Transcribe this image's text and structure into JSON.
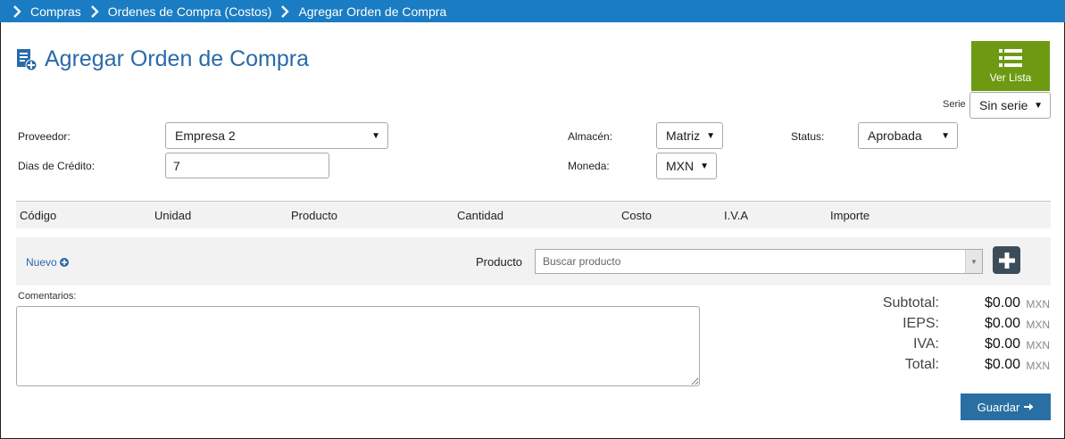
{
  "breadcrumb": [
    {
      "label": "Compras"
    },
    {
      "label": "Ordenes de Compra (Costos)"
    },
    {
      "label": "Agregar Orden de Compra"
    }
  ],
  "page_title": "Agregar Orden de Compra",
  "ver_lista_label": "Ver Lista",
  "serie": {
    "label": "Serie",
    "value": "Sin serie"
  },
  "form": {
    "proveedor": {
      "label": "Proveedor:",
      "value": "Empresa 2"
    },
    "dias_credito": {
      "label": "Dias de Crédito:",
      "value": "7"
    },
    "almacen": {
      "label": "Almacén:",
      "value": "Matriz"
    },
    "moneda": {
      "label": "Moneda:",
      "value": "MXN"
    },
    "status": {
      "label": "Status:",
      "value": "Aprobada"
    }
  },
  "table": {
    "columns": [
      "Código",
      "Unidad",
      "Producto",
      "Cantidad",
      "Costo",
      "I.V.A",
      "Importe"
    ]
  },
  "add_row": {
    "nuevo_label": "Nuevo",
    "producto_label": "Producto",
    "search_placeholder": "Buscar producto"
  },
  "comments_label": "Comentarios:",
  "totals": [
    {
      "label": "Subtotal:",
      "value": "$0.00",
      "currency": "MXN"
    },
    {
      "label": "IEPS:",
      "value": "$0.00",
      "currency": "MXN"
    },
    {
      "label": "IVA:",
      "value": "$0.00",
      "currency": "MXN"
    },
    {
      "label": "Total:",
      "value": "$0.00",
      "currency": "MXN"
    }
  ],
  "guardar_label": "Guardar",
  "colors": {
    "breadcrumb_bg": "#1a7cc2",
    "title": "#2a6aa9",
    "ver_lista_bg": "#6d9a12",
    "guardar_bg": "#2a6fa3",
    "add_button_bg": "#3d4c59"
  },
  "icons": {
    "breadcrumb_separator": "chevron-right-icon",
    "title": "document-add-icon",
    "ver_lista": "list-icon",
    "nuevo": "plus-circle-icon",
    "add_product": "plus-icon",
    "guardar": "arrow-right-icon"
  }
}
